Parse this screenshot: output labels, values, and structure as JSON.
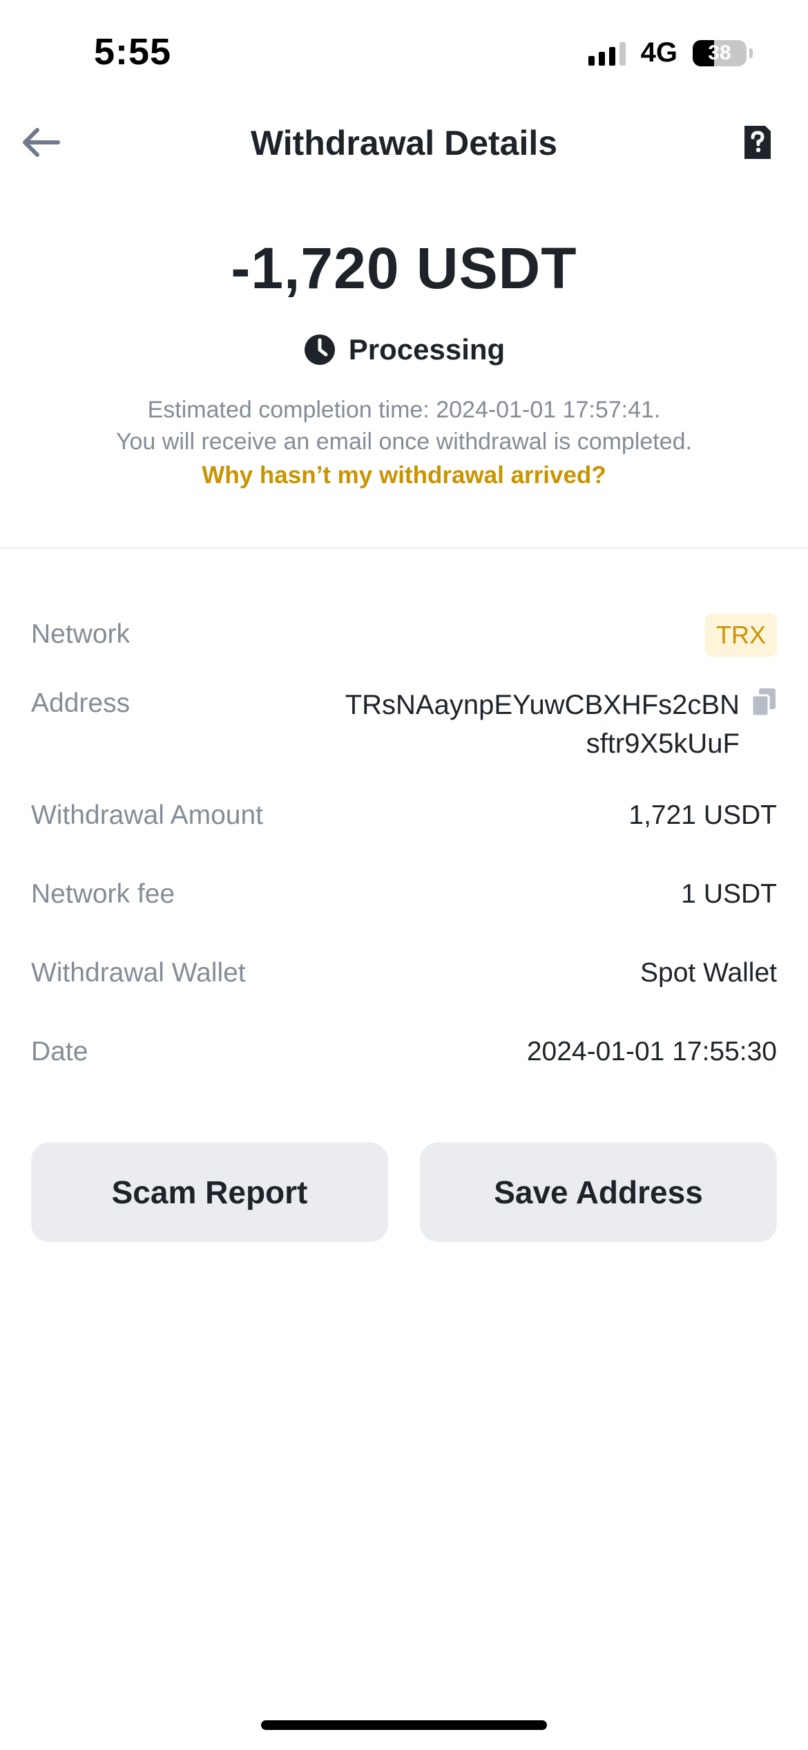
{
  "status_bar": {
    "time": "5:55",
    "network": "4G",
    "battery": "38"
  },
  "header": {
    "title": "Withdrawal Details",
    "back_icon": "arrow-left-icon",
    "help_icon": "help-document-icon"
  },
  "summary": {
    "amount": "-1,720 USDT",
    "status": "Processing",
    "status_icon": "clock-icon",
    "note_line1": "Estimated completion time: 2024-01-01 17:57:41.",
    "note_line2": "You will receive an email once withdrawal is completed.",
    "help_link": "Why hasn’t my withdrawal arrived?"
  },
  "details": {
    "network": {
      "label": "Network",
      "value": "TRX"
    },
    "address": {
      "label": "Address",
      "line1": "TRsNAaynpEYuwCBXHFs2cBN",
      "line2": "sftr9X5kUuF",
      "copy_icon": "copy-icon"
    },
    "withdrawal_amount": {
      "label": "Withdrawal Amount",
      "value": "1,721 USDT"
    },
    "network_fee": {
      "label": "Network fee",
      "value": "1 USDT"
    },
    "withdrawal_wallet": {
      "label": "Withdrawal Wallet",
      "value": "Spot Wallet"
    },
    "date": {
      "label": "Date",
      "value": "2024-01-01 17:55:30"
    }
  },
  "actions": {
    "scam_report": "Scam Report",
    "save_address": "Save Address"
  },
  "colors": {
    "accent": "#c99400",
    "chip_bg": "#fdf4d9",
    "muted_text": "#858c96",
    "button_bg": "#eaecef",
    "primary_text": "#1e2329"
  }
}
